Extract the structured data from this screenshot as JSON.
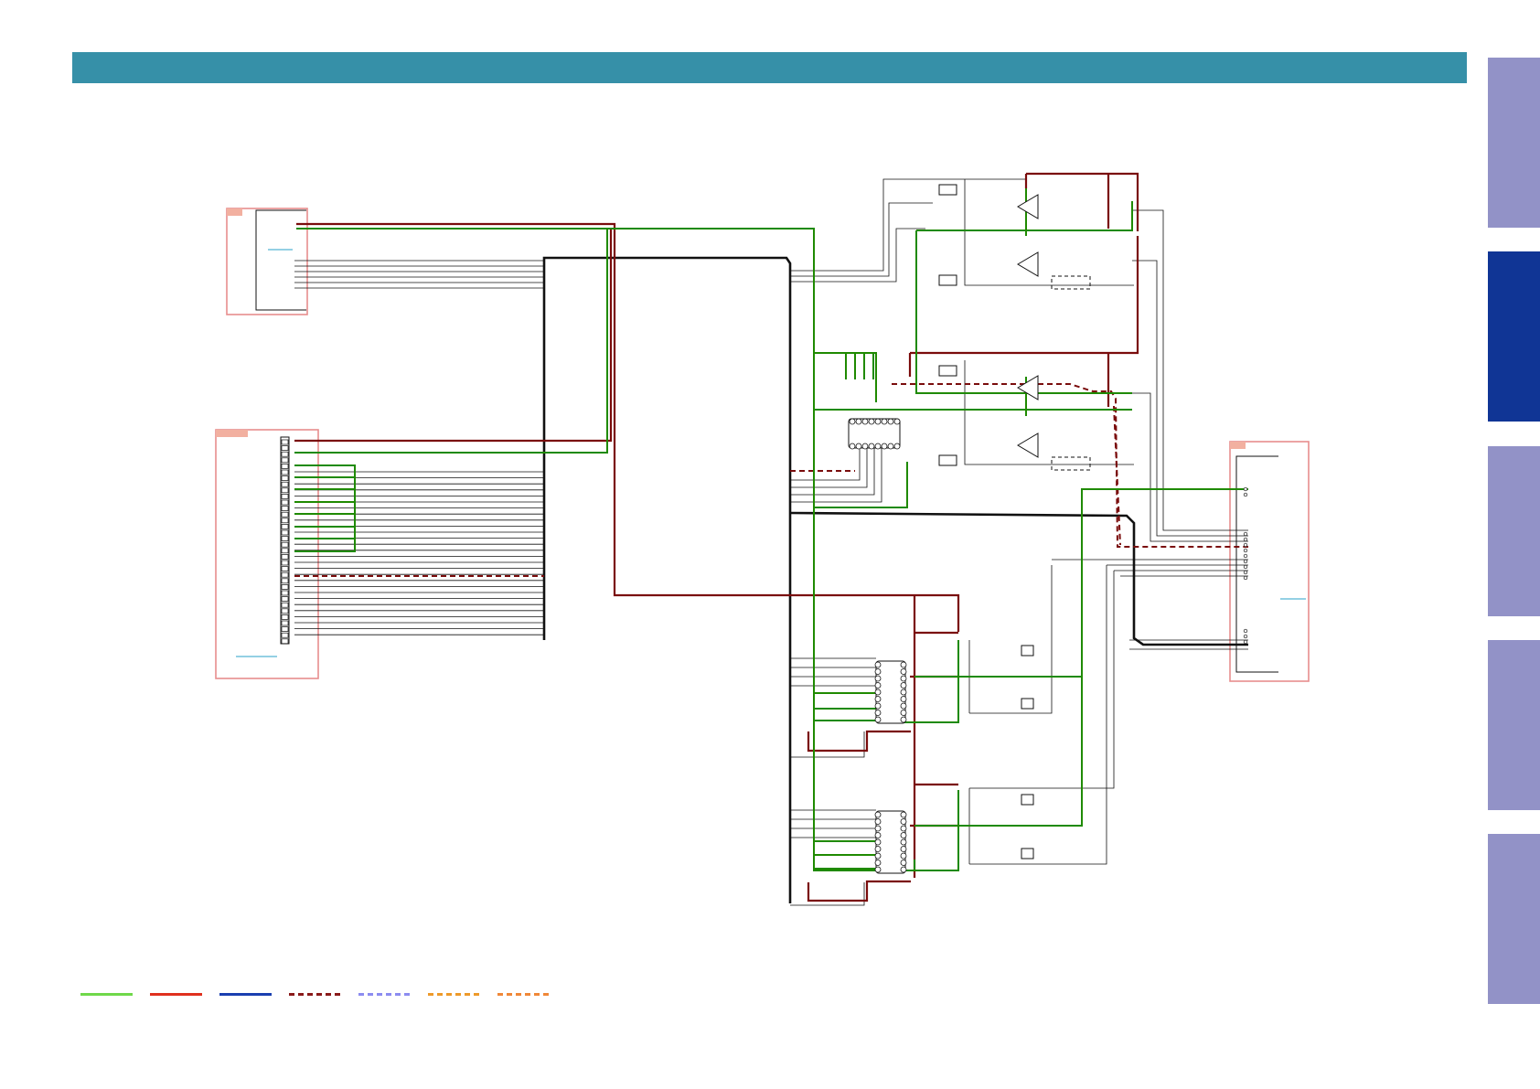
{
  "colors": {
    "header": "#3690a8",
    "tab_inactive": "#9292c7",
    "tab_active": "#103595",
    "wire_green": "#1f8a00",
    "wire_darkred": "#7a0c0c",
    "wire_black": "#111111",
    "block_outline": "#e88e8e",
    "block_tag": "#f2b0a0",
    "net_label": "#28a0c8"
  },
  "side_tabs": [
    {
      "name": "side-tab-1",
      "active": false
    },
    {
      "name": "side-tab-2",
      "active": true
    },
    {
      "name": "side-tab-3",
      "active": false
    },
    {
      "name": "side-tab-4",
      "active": false
    },
    {
      "name": "side-tab-5",
      "active": false
    }
  ],
  "legend": [
    {
      "name": "legend-green-solid",
      "color": "#6fd84a",
      "style": "solid"
    },
    {
      "name": "legend-red-solid",
      "color": "#e0301e",
      "style": "solid"
    },
    {
      "name": "legend-blue-solid",
      "color": "#1a3fb0",
      "style": "solid"
    },
    {
      "name": "legend-darkred-dashed",
      "color": "#8a1a1a",
      "style": "dashed"
    },
    {
      "name": "legend-lavender-dashed",
      "color": "#8c8cf0",
      "style": "dashed"
    },
    {
      "name": "legend-orange-dashed",
      "color": "#ee9a2a",
      "style": "dashed"
    },
    {
      "name": "legend-orange2-dashed",
      "color": "#f08838",
      "style": "dashed"
    }
  ]
}
